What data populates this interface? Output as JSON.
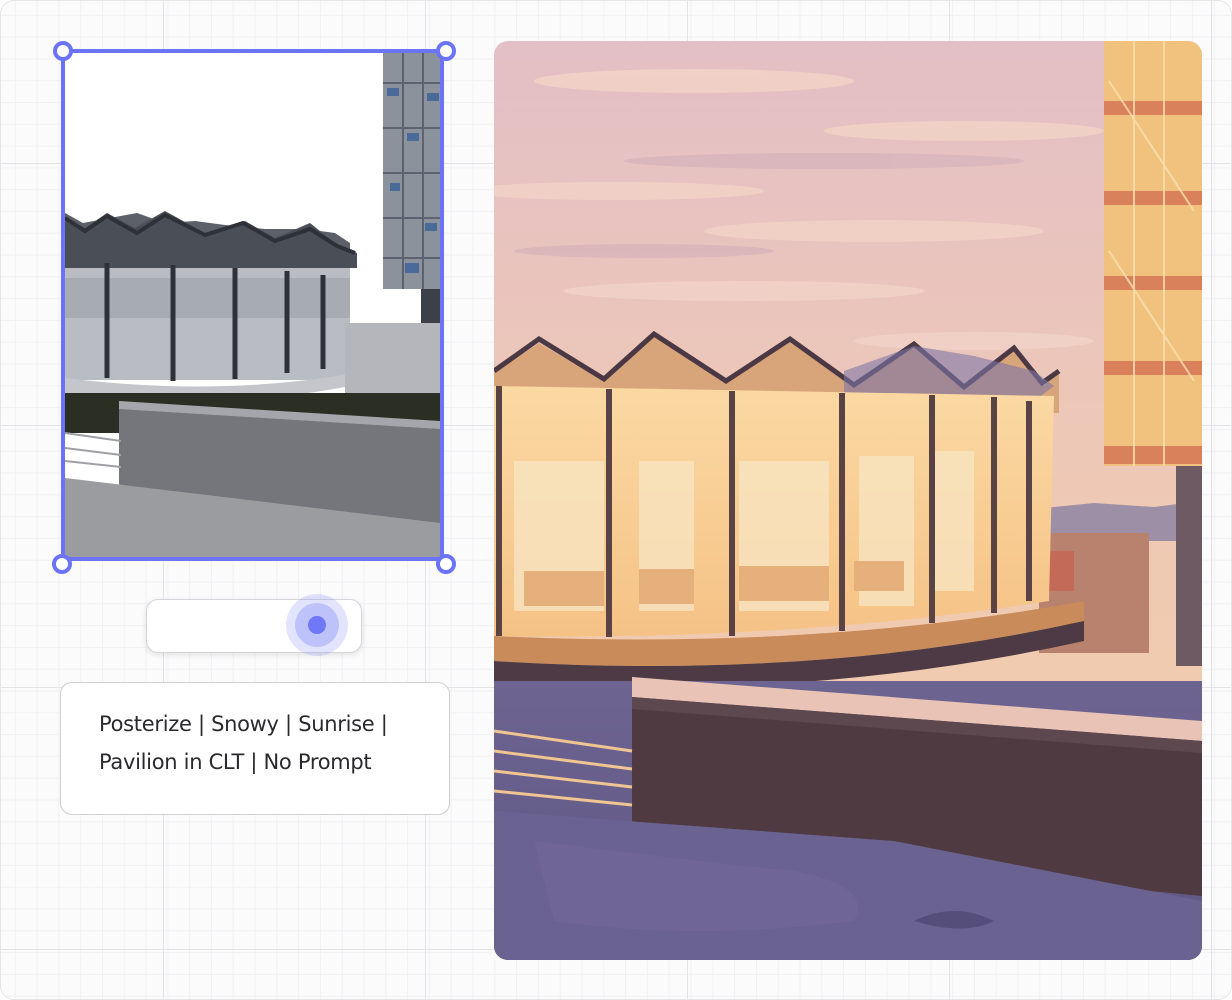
{
  "source_view": {
    "kind": "rendered model view",
    "handle_color": "#6b74f6"
  },
  "toggle": {
    "state": "on",
    "accent": "#6f78f6"
  },
  "prompt": {
    "line1": "Posterize | Snowy | Sunrise |",
    "line2": "Pavilion in CLT | No Prompt"
  },
  "result_view": {
    "kind": "stylized render"
  }
}
